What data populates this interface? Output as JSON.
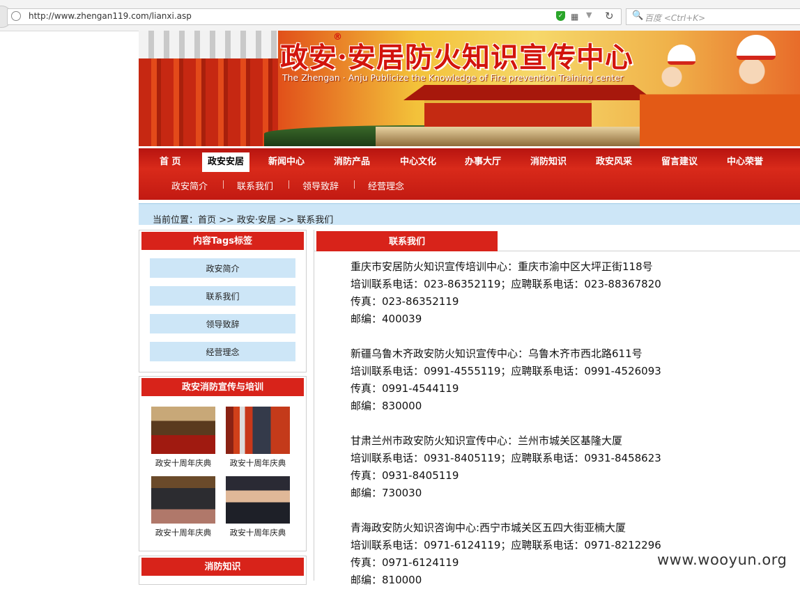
{
  "browser": {
    "url": "http://www.zhengan119.com/lianxi.asp",
    "search_placeholder": "百度 <Ctrl+K>"
  },
  "banner": {
    "title": "政安·安居防火知识宣传中心",
    "registered": "®",
    "subtitle": "The Zhengan · Anju Publicize the Knowledge of Fire prevention Training center"
  },
  "nav": {
    "main": [
      "首 页",
      "政安安居",
      "新闻中心",
      "消防产品",
      "中心文化",
      "办事大厅",
      "消防知识",
      "政安风采",
      "留言建议",
      "中心荣誉"
    ],
    "active_index": 1,
    "sub": [
      "政安简介",
      "联系我们",
      "领导致辞",
      "经营理念"
    ]
  },
  "breadcrumb": "当前位置：首页 >> 政安·安居 >> 联系我们",
  "sidebar": {
    "tags_title": "内容Tags标签",
    "tags": [
      "政安简介",
      "联系我们",
      "领导致辞",
      "经营理念"
    ],
    "promo_title": "政安消防宣传与培训",
    "promo_items": [
      "政安十周年庆典",
      "政安十周年庆典",
      "政安十周年庆典",
      "政安十周年庆典"
    ],
    "fire_title": "消防知识"
  },
  "content": {
    "tab_title": "联系我们",
    "entries": [
      {
        "name": "重庆市安居防火知识宣传培训中心：重庆市渝中区大坪正街118号",
        "phone": "培训联系电话：023-86352119；应聘联系电话：023-88367820",
        "fax": "传真：023-86352119",
        "postcode": "邮编：400039"
      },
      {
        "name": "新疆乌鲁木齐政安防火知识宣传中心：乌鲁木齐市西北路611号",
        "phone": "培训联系电话：0991-4555119；应聘联系电话：0991-4526093",
        "fax": "传真：0991-4544119",
        "postcode": "邮编：830000"
      },
      {
        "name": "甘肃兰州市政安防火知识宣传中心：兰州市城关区基隆大厦",
        "phone": "培训联系电话：0931-8405119；应聘联系电话：0931-8458623",
        "fax": "传真：0931-8405119",
        "postcode": "邮编：730030"
      },
      {
        "name": "青海政安防火知识咨询中心:西宁市城关区五四大街亚楠大厦",
        "phone": "培训联系电话：0971-6124119；应聘联系电话：0971-8212296",
        "fax": "传真：0971-6124119",
        "postcode": "邮编：810000"
      }
    ]
  },
  "watermark": "www.wooyun.org",
  "colors": {
    "nav_red": "#d8231a",
    "light_blue": "#cde6f7",
    "title_red": "#d2140c"
  }
}
